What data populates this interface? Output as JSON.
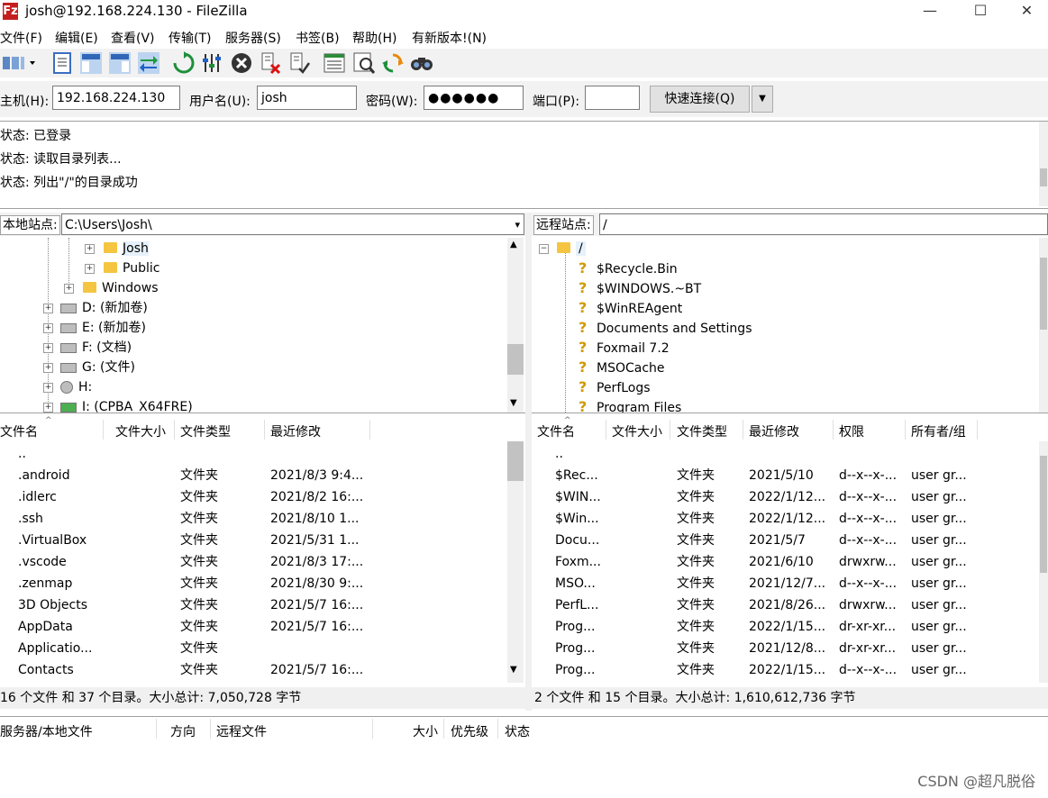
{
  "window": {
    "title": "josh@192.168.224.130 - FileZilla",
    "app_icon": "Fz",
    "minimize": "—",
    "maximize": "☐",
    "close": "✕"
  },
  "menu": [
    "文件(F)",
    "编辑(E)",
    "查看(V)",
    "传输(T)",
    "服务器(S)",
    "书签(B)",
    "帮助(H)",
    "有新版本!(N)"
  ],
  "quickconnect": {
    "host_label": "主机(H):",
    "host_value": "192.168.224.130",
    "user_label": "用户名(U):",
    "user_value": "josh",
    "pass_label": "密码(W):",
    "pass_value": "●●●●●●",
    "port_label": "端口(P):",
    "port_value": "",
    "connect_label": "快速连接(Q)"
  },
  "log": [
    "状态: 已登录",
    "状态: 读取目录列表...",
    "状态: 列出\"/\"的目录成功"
  ],
  "local": {
    "site_label": "本地站点:",
    "path": "C:\\Users\\Josh\\",
    "tree": [
      {
        "name": "Josh",
        "icon": "user-folder-icon"
      },
      {
        "name": "Public",
        "icon": "folder-icon"
      },
      {
        "name": "Windows",
        "icon": "folder-icon"
      },
      {
        "name": "D: (新加卷)",
        "icon": "drive-icon"
      },
      {
        "name": "E: (新加卷)",
        "icon": "drive-icon"
      },
      {
        "name": "F: (文档)",
        "icon": "drive-icon"
      },
      {
        "name": "G: (文件)",
        "icon": "drive-icon"
      },
      {
        "name": "H:",
        "icon": "cd-drive-icon"
      },
      {
        "name": "I: (CPBA_X64FRE)",
        "icon": "install-drive-icon"
      }
    ],
    "columns": [
      "文件名",
      "文件大小",
      "文件类型",
      "最近修改"
    ],
    "files": [
      {
        "name": "..",
        "size": "",
        "type": "",
        "modified": ""
      },
      {
        "name": ".android",
        "size": "",
        "type": "文件夹",
        "modified": "2021/8/3 9:4..."
      },
      {
        "name": ".idlerc",
        "size": "",
        "type": "文件夹",
        "modified": "2021/8/2 16:..."
      },
      {
        "name": ".ssh",
        "size": "",
        "type": "文件夹",
        "modified": "2021/8/10 1..."
      },
      {
        "name": ".VirtualBox",
        "size": "",
        "type": "文件夹",
        "modified": "2021/5/31 1..."
      },
      {
        "name": ".vscode",
        "size": "",
        "type": "文件夹",
        "modified": "2021/8/3 17:..."
      },
      {
        "name": ".zenmap",
        "size": "",
        "type": "文件夹",
        "modified": "2021/8/30 9:..."
      },
      {
        "name": "3D Objects",
        "size": "",
        "type": "文件夹",
        "modified": "2021/5/7 16:..."
      },
      {
        "name": "AppData",
        "size": "",
        "type": "文件夹",
        "modified": "2021/5/7 16:..."
      },
      {
        "name": "Applicatio...",
        "size": "",
        "type": "文件夹",
        "modified": ""
      },
      {
        "name": "Contacts",
        "size": "",
        "type": "文件夹",
        "modified": "2021/5/7 16:..."
      }
    ],
    "status": "16 个文件 和 37 个目录。大小总计: 7,050,728 字节"
  },
  "remote": {
    "site_label": "远程站点:",
    "path": "/",
    "tree": [
      {
        "name": "/",
        "icon": "folder-icon"
      },
      {
        "name": "$Recycle.Bin",
        "icon": "unknown-icon"
      },
      {
        "name": "$WINDOWS.~BT",
        "icon": "unknown-icon"
      },
      {
        "name": "$WinREAgent",
        "icon": "unknown-icon"
      },
      {
        "name": "Documents and Settings",
        "icon": "unknown-icon"
      },
      {
        "name": "Foxmail 7.2",
        "icon": "unknown-icon"
      },
      {
        "name": "MSOCache",
        "icon": "unknown-icon"
      },
      {
        "name": "PerfLogs",
        "icon": "unknown-icon"
      },
      {
        "name": "Program Files",
        "icon": "unknown-icon"
      }
    ],
    "columns": [
      "文件名",
      "文件大小",
      "文件类型",
      "最近修改",
      "权限",
      "所有者/组"
    ],
    "files": [
      {
        "name": "..",
        "size": "",
        "type": "",
        "modified": "",
        "perm": "",
        "owner": ""
      },
      {
        "name": "$Rec...",
        "size": "",
        "type": "文件夹",
        "modified": "2021/5/10",
        "perm": "d--x--x-...",
        "owner": "user gr..."
      },
      {
        "name": "$WIN...",
        "size": "",
        "type": "文件夹",
        "modified": "2022/1/12...",
        "perm": "d--x--x-...",
        "owner": "user gr..."
      },
      {
        "name": "$Win...",
        "size": "",
        "type": "文件夹",
        "modified": "2022/1/12...",
        "perm": "d--x--x-...",
        "owner": "user gr..."
      },
      {
        "name": "Docu...",
        "size": "",
        "type": "文件夹",
        "modified": "2021/5/7",
        "perm": "d--x--x-...",
        "owner": "user gr..."
      },
      {
        "name": "Foxm...",
        "size": "",
        "type": "文件夹",
        "modified": "2021/6/10",
        "perm": "drwxrw...",
        "owner": "user gr..."
      },
      {
        "name": "MSO...",
        "size": "",
        "type": "文件夹",
        "modified": "2021/12/7...",
        "perm": "d--x--x-...",
        "owner": "user gr..."
      },
      {
        "name": "PerfL...",
        "size": "",
        "type": "文件夹",
        "modified": "2021/8/26...",
        "perm": "drwxrw...",
        "owner": "user gr..."
      },
      {
        "name": "Prog...",
        "size": "",
        "type": "文件夹",
        "modified": "2022/1/15...",
        "perm": "dr-xr-xr...",
        "owner": "user gr..."
      },
      {
        "name": "Prog...",
        "size": "",
        "type": "文件夹",
        "modified": "2021/12/8...",
        "perm": "dr-xr-xr...",
        "owner": "user gr..."
      },
      {
        "name": "Prog...",
        "size": "",
        "type": "文件夹",
        "modified": "2022/1/15...",
        "perm": "d--x--x-...",
        "owner": "user gr..."
      }
    ],
    "status": "2 个文件 和 15 个目录。大小总计: 1,610,612,736 字节"
  },
  "queue": {
    "columns": [
      "服务器/本地文件",
      "方向",
      "远程文件",
      "大小",
      "优先级",
      "状态"
    ]
  },
  "watermark": "CSDN @超凡脱俗",
  "colors": {
    "folder": "#f5c542",
    "app_icon": "#c41f1f",
    "unknown": "#d19a00"
  }
}
